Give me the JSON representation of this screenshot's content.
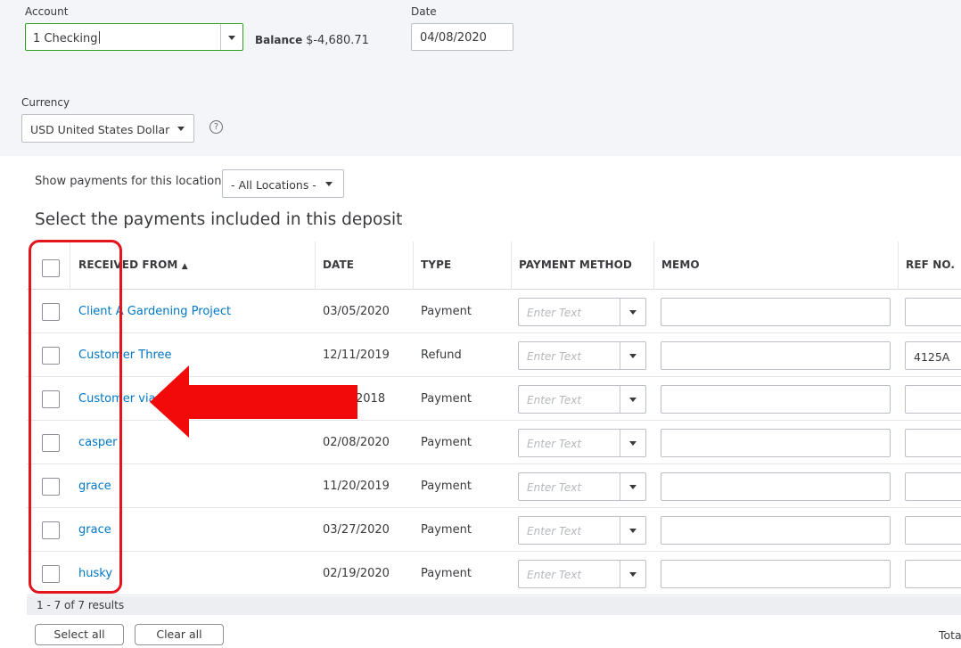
{
  "account": {
    "label": "Account",
    "value": "1 Checking"
  },
  "balance": {
    "label": "Balance",
    "amount": "$-4,680.71"
  },
  "date": {
    "label": "Date",
    "value": "04/08/2020"
  },
  "currency": {
    "label": "Currency",
    "value": "USD United States Dollar",
    "help": "?"
  },
  "location_filter": {
    "label": "Show payments for this location:",
    "value": "- All Locations -"
  },
  "section_title": "Select the payments included in this deposit",
  "table": {
    "headers": {
      "received_from": "RECEIVED FROM",
      "sort_indicator": "▲",
      "date": "DATE",
      "type": "TYPE",
      "payment_method": "PAYMENT METHOD",
      "memo": "MEMO",
      "ref_no": "REF NO."
    },
    "payment_method_placeholder": "Enter Text",
    "rows": [
      {
        "received_from": "Client A Gardening Project",
        "date": "03/05/2020",
        "type": "Payment",
        "ref": ""
      },
      {
        "received_from": "Customer Three",
        "date": "12/11/2019",
        "type": "Refund",
        "ref": "4125A"
      },
      {
        "received_from": "Customer via P",
        "date": "2018",
        "type": "Payment",
        "ref": ""
      },
      {
        "received_from": "casper",
        "date": "02/08/2020",
        "type": "Payment",
        "ref": ""
      },
      {
        "received_from": "grace",
        "date": "11/20/2019",
        "type": "Payment",
        "ref": ""
      },
      {
        "received_from": "grace",
        "date": "03/27/2020",
        "type": "Payment",
        "ref": ""
      },
      {
        "received_from": "husky",
        "date": "02/19/2020",
        "type": "Payment",
        "ref": ""
      }
    ]
  },
  "results_text": "1 - 7 of 7 results",
  "buttons": {
    "select_all": "Select all",
    "clear_all": "Clear all"
  },
  "total_label": "Total",
  "colors": {
    "link": "#0077c5",
    "accent_green": "#2ca01c",
    "annotation_red": "#e3141b"
  }
}
